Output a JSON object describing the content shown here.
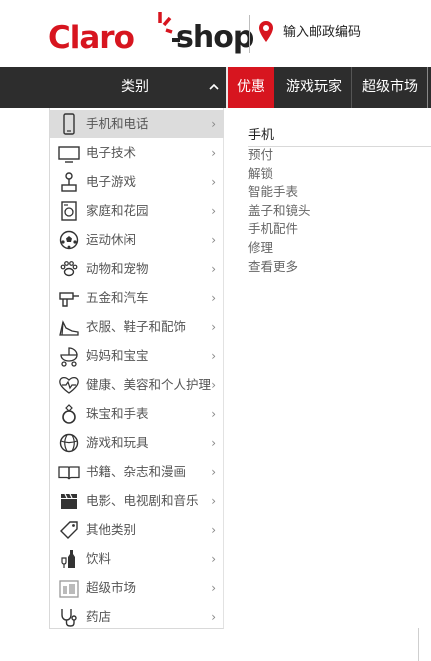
{
  "brand": {
    "logo_text": "Claro·shop",
    "logo_left": "Claro",
    "logo_right": "shop",
    "red": "#d7151f",
    "dark": "#2d2d2d"
  },
  "header": {
    "postcode_label": "输入邮政编码",
    "postcode_icon": "location-pin-icon"
  },
  "nav": {
    "categories_label": "类别",
    "tabs": [
      {
        "label": "优惠",
        "active": true
      },
      {
        "label": "游戏玩家",
        "active": false
      },
      {
        "label": "超级市场",
        "active": false
      }
    ]
  },
  "categories": [
    {
      "label": "手机和电话",
      "icon": "smartphone-icon",
      "active": true
    },
    {
      "label": "电子技术",
      "icon": "monitor-icon",
      "active": false
    },
    {
      "label": "电子游戏",
      "icon": "joystick-icon",
      "active": false
    },
    {
      "label": "家庭和花园",
      "icon": "washing-machine-icon",
      "active": false
    },
    {
      "label": "运动休闲",
      "icon": "soccer-ball-icon",
      "active": false
    },
    {
      "label": "动物和宠物",
      "icon": "paw-icon",
      "active": false
    },
    {
      "label": "五金和汽车",
      "icon": "drill-icon",
      "active": false
    },
    {
      "label": "衣服、鞋子和配饰",
      "icon": "high-heel-icon",
      "active": false
    },
    {
      "label": "妈妈和宝宝",
      "icon": "stroller-icon",
      "active": false
    },
    {
      "label": "健康、美容和个人护理",
      "icon": "heartbeat-icon",
      "active": false
    },
    {
      "label": "珠宝和手表",
      "icon": "ring-icon",
      "active": false
    },
    {
      "label": "游戏和玩具",
      "icon": "ball-icon",
      "active": false
    },
    {
      "label": "书籍、杂志和漫画",
      "icon": "book-icon",
      "active": false
    },
    {
      "label": "电影、电视剧和音乐",
      "icon": "clapperboard-icon",
      "active": false
    },
    {
      "label": "其他类别",
      "icon": "tag-icon",
      "active": false
    },
    {
      "label": "饮料",
      "icon": "bottle-icon",
      "active": false
    },
    {
      "label": "超级市场",
      "icon": "supermarket-icon",
      "active": false
    },
    {
      "label": "药店",
      "icon": "stethoscope-icon",
      "active": false
    }
  ],
  "subcategory": {
    "title": "手机",
    "items": [
      "预付",
      "解锁",
      "智能手表",
      "盖子和镜头",
      "手机配件",
      "修理",
      "查看更多"
    ]
  },
  "chevron": "›"
}
